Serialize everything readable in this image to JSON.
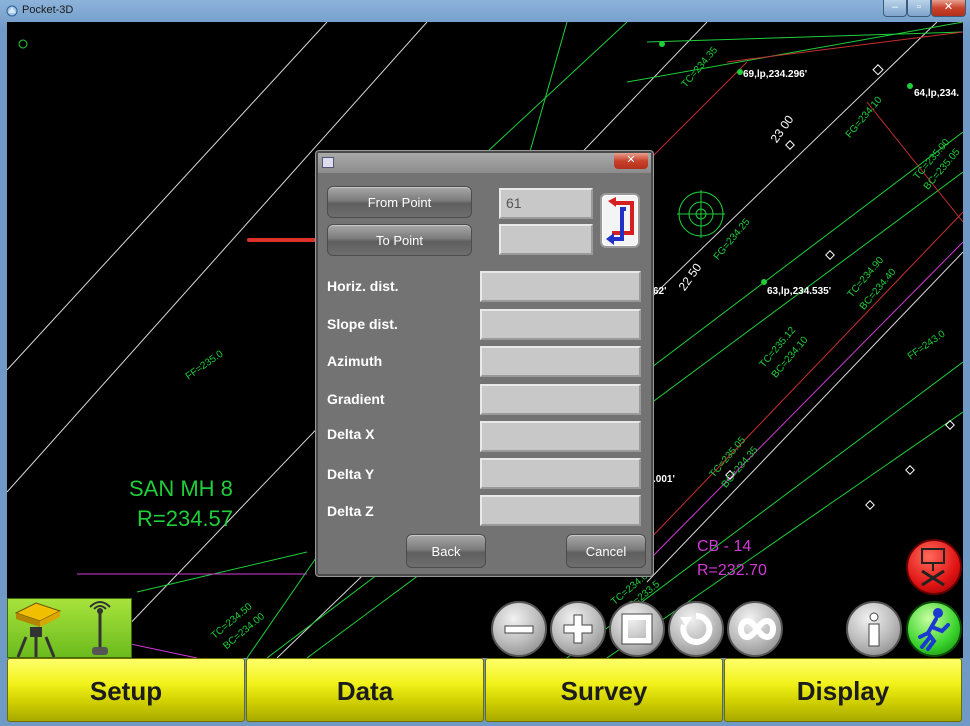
{
  "window": {
    "title": "Pocket-3D",
    "minimize": "–",
    "maximize": "▫",
    "close": "✕"
  },
  "map": {
    "point_labels": [
      "69,lp,234.296'",
      "64,lp,234.",
      "63,lp,234.535'",
      "62'",
      ".001'"
    ],
    "station_labels": [
      "23 00",
      "22 50"
    ],
    "elevation_labels": [
      "FF=235.0",
      "FF=243.0",
      "FG=234.10",
      "FG=234.25",
      "TC=234.35",
      "TC=235.12",
      "BC=234.10",
      "TC=234.90",
      "BC=234.40",
      "TC=235.05",
      "BC=234.35",
      "TC=235.00",
      "BC=235.05",
      "TC=234.50",
      "BC=234.00",
      "TC=234.02",
      "BC=233.5"
    ],
    "san_mh": {
      "name": "SAN  MH  8",
      "rim": "R=234.57"
    },
    "cb": {
      "name": "CB  -   14",
      "rim": "R=232.70"
    }
  },
  "dialog": {
    "close": "✕",
    "from_point_label": "From Point",
    "to_point_label": "To Point",
    "from_point_value": "61",
    "to_point_value": "",
    "rows": [
      {
        "label": "Horiz. dist.",
        "value": ""
      },
      {
        "label": "Slope dist.",
        "value": ""
      },
      {
        "label": "Azimuth",
        "value": ""
      },
      {
        "label": "Gradient",
        "value": ""
      },
      {
        "label": "Delta X",
        "value": ""
      },
      {
        "label": "Delta Y",
        "value": ""
      },
      {
        "label": "Delta Z",
        "value": ""
      }
    ],
    "back_label": "Back",
    "cancel_label": "Cancel"
  },
  "menu": {
    "setup": "Setup",
    "data": "Data",
    "survey": "Survey",
    "display": "Display"
  },
  "toolbar_icons": [
    "zoom-out-icon",
    "zoom-in-icon",
    "zoom-extents-icon",
    "refresh-icon",
    "infinity-icon",
    "info-icon",
    "walk-icon",
    "stakeout-icon"
  ],
  "colors": {
    "menu_yellow": "#f1f11a",
    "status_green": "#8fd42c",
    "dialog_gray": "#737373",
    "cad_green": "#1ecf3a",
    "cad_magenta": "#d23ad6"
  }
}
